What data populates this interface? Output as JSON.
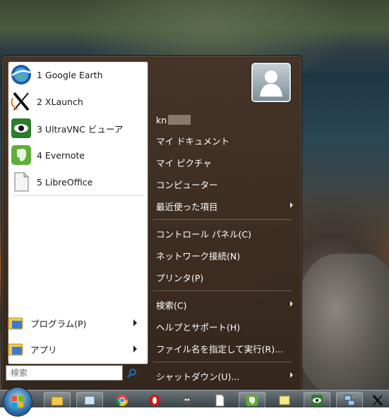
{
  "pinned_programs": [
    {
      "label": "1 Google Earth",
      "icon": "google-earth-icon"
    },
    {
      "label": "2 XLaunch",
      "icon": "xlaunch-icon"
    },
    {
      "label": "3 UltraVNC ビューア",
      "icon": "ultravnc-icon"
    },
    {
      "label": "4 Evernote",
      "icon": "evernote-icon"
    },
    {
      "label": "5 LibreOffice",
      "icon": "libreoffice-icon"
    }
  ],
  "left_menu": {
    "programs_label": "プログラム(P)",
    "apps_label": "アプリ"
  },
  "search": {
    "placeholder": "検索"
  },
  "right_menu": {
    "username": "kn",
    "items": [
      "マイ ドキュメント",
      "マイ ピクチャ",
      "コンピューター",
      "最近使った項目",
      "コントロール パネル(C)",
      "ネットワーク接続(N)",
      "プリンタ(P)",
      "検索(C)",
      "ヘルプとサポート(H)",
      "ファイル名を指定して実行(R)...",
      "シャットダウン(U)..."
    ]
  },
  "colors": {
    "menu_bg": "#463426",
    "left_pane_bg": "#ffffff",
    "text_dark": "#1a1a1a",
    "text_light": "#ffffff"
  }
}
